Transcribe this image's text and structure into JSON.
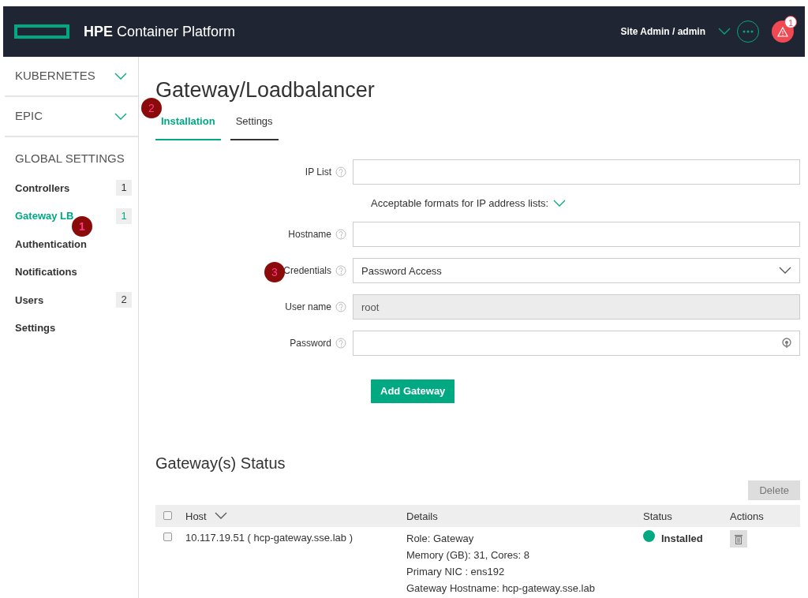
{
  "header": {
    "brand": "HPE",
    "product": "Container Platform",
    "user": "Site Admin / admin",
    "alert_count": "1"
  },
  "sidebar": {
    "sections": [
      {
        "label": "KUBERNETES",
        "expanded": false
      },
      {
        "label": "EPIC",
        "expanded": false
      }
    ],
    "global": {
      "heading": "GLOBAL SETTINGS",
      "items": [
        {
          "label": "Controllers",
          "count": "1",
          "selected": false
        },
        {
          "label": "Gateway LB",
          "count": "1",
          "selected": true,
          "annotation": "1"
        },
        {
          "label": "Authentication",
          "selected": false
        },
        {
          "label": "Notifications",
          "selected": false
        },
        {
          "label": "Users",
          "count": "2",
          "selected": false
        },
        {
          "label": "Settings",
          "selected": false
        }
      ]
    }
  },
  "page_title": "Gateway/Loadbalancer",
  "tabs": [
    {
      "label": "Installation",
      "selected": true,
      "annotation": "2"
    },
    {
      "label": "Settings",
      "selected": false
    }
  ],
  "form": {
    "fields": [
      {
        "label": "IP List",
        "kind": "text"
      },
      {
        "kind": "hint",
        "label": "Acceptable formats for IP address lists:"
      },
      {
        "label": "Hostname",
        "kind": "text"
      },
      {
        "label": "Credentials",
        "kind": "select",
        "value": "Password Access",
        "annotation": "3"
      },
      {
        "label": "User name",
        "kind": "text",
        "value": "root",
        "disabled": true
      },
      {
        "label": "Password",
        "kind": "password"
      }
    ],
    "submit": "Add Gateway"
  },
  "status": {
    "title": "Gateway(s) Status",
    "all_checked": false,
    "delete": {
      "label": "Delete",
      "disabled": true
    },
    "columns": [
      "Host",
      "Details",
      "Status",
      "Actions"
    ],
    "rows": [
      {
        "checked": false,
        "host": "10.117.19.51 ( hcp-gateway.sse.lab )",
        "details": [
          "Role: Gateway",
          "Memory (GB): 31, Cores: 8",
          "Primary NIC : ens192",
          "Gateway Hostname: hcp-gateway.sse.lab"
        ],
        "status": "Installed",
        "color": "#01a982"
      }
    ]
  }
}
